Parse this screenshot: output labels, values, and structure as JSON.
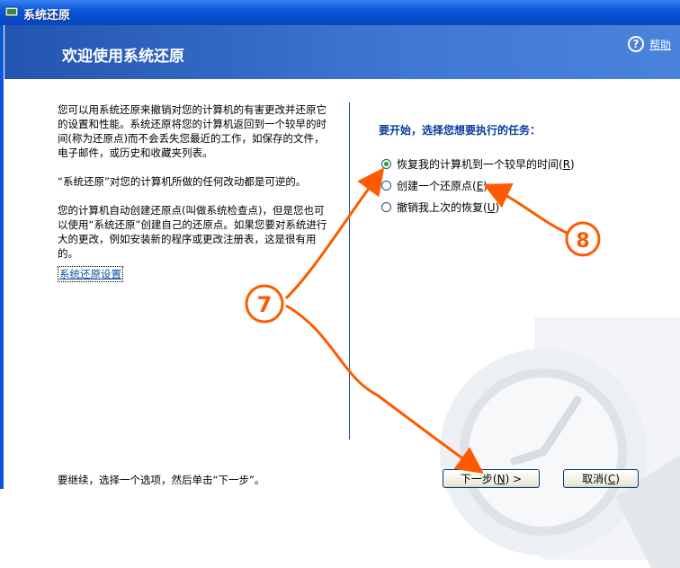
{
  "window": {
    "title": "系统还原"
  },
  "header": {
    "heading": "欢迎使用系统还原",
    "help_label": "帮助",
    "help_icon": "question-icon"
  },
  "left": {
    "paragraphs": [
      "您可以用系统还原来撤销对您的计算机的有害更改并还原它的设置和性能。系统还原将您的计算机返回到一个较早的时间(称为还原点)而不会丢失您最近的工作，如保存的文件，电子邮件，或历史和收藏夹列表。",
      "“系统还原”对您的计算机所做的任何改动都是可逆的。",
      "您的计算机自动创建还原点(叫做系统检查点)，但是您也可以使用“系统还原”创建自己的还原点。如果您要对系统进行大的更改，例如安装新的程序或更改注册表，这是很有用的。"
    ],
    "settings_link": "系统还原设置"
  },
  "right": {
    "prompt": "要开始，选择您想要执行的任务：",
    "options": [
      {
        "label": "恢复我的计算机到一个较早的时间",
        "key": "R",
        "checked": true
      },
      {
        "label": "创建一个还原点",
        "key": "E",
        "checked": false
      },
      {
        "label": "撤销我上次的恢复",
        "key": "U",
        "checked": false
      }
    ]
  },
  "footer": {
    "instruction": "要继续，选择一个选项，然后单击“下一步”。",
    "next_label": "下一步",
    "next_key": "N",
    "cancel_label": "取消",
    "cancel_key": "C"
  },
  "annotations": {
    "arrow_7": "7",
    "arrow_8": "8",
    "color": "#ff5a00"
  },
  "colors": {
    "title_bar": "#0a58d8",
    "banner": "#3f78d4",
    "link": "#0d4fa8",
    "prompt": "#0b3c9e"
  }
}
